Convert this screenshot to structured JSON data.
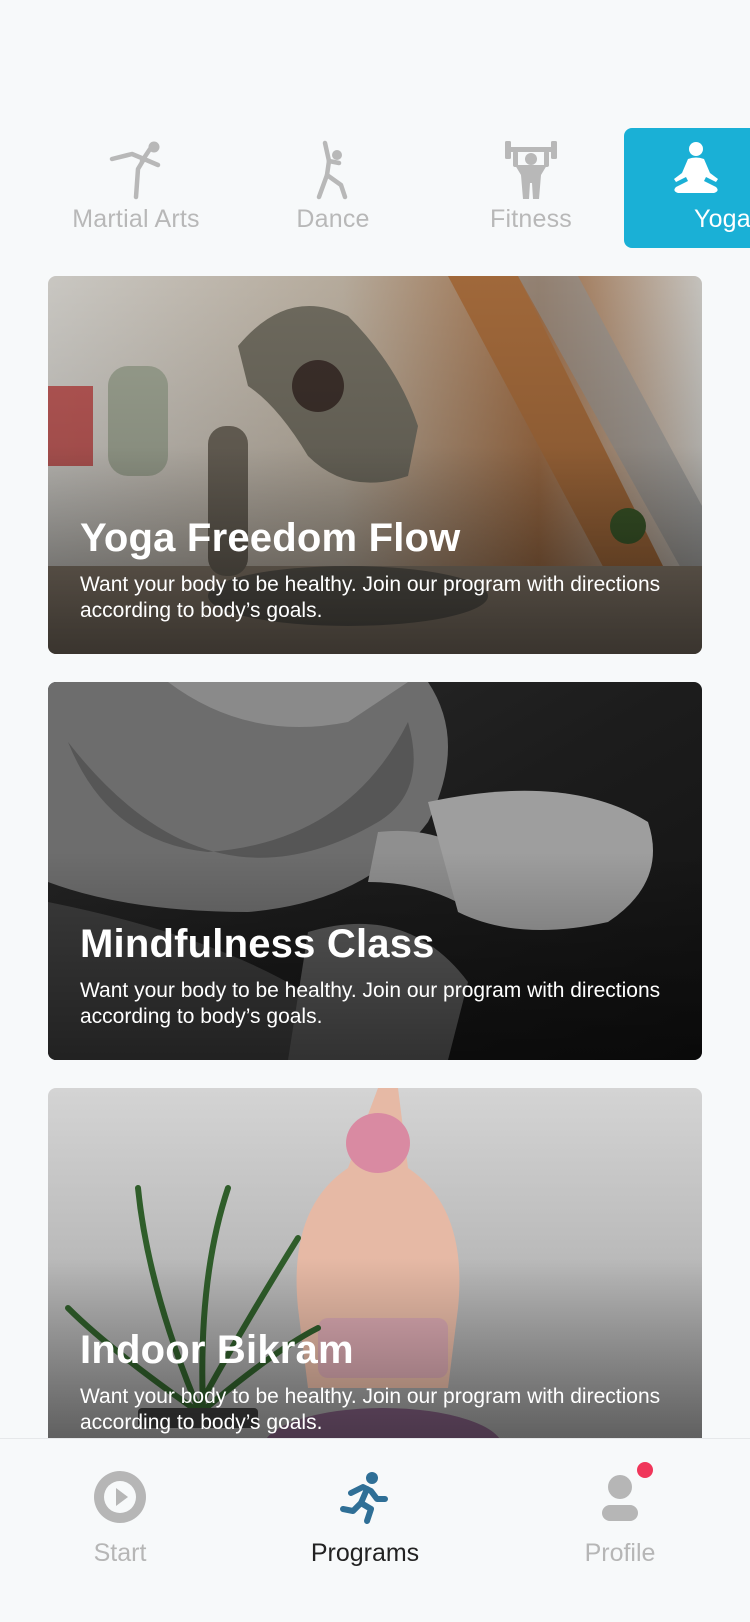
{
  "categories": [
    {
      "label": "Martial Arts",
      "icon": "martial-arts-icon",
      "selected": false
    },
    {
      "label": "Dance",
      "icon": "dance-icon",
      "selected": false
    },
    {
      "label": "Fitness",
      "icon": "fitness-icon",
      "selected": false
    },
    {
      "label": "Yoga",
      "icon": "yoga-icon",
      "selected": true
    }
  ],
  "programs": [
    {
      "title": "Yoga Freedom Flow",
      "description": "Want your body to be healthy. Join our program with directions according to body’s goals."
    },
    {
      "title": "Mindfulness Class",
      "description": "Want your body to be healthy. Join our program with directions according to body’s goals."
    },
    {
      "title": "Indoor Bikram",
      "description": "Want your body to be healthy. Join our program with directions according to body’s goals."
    }
  ],
  "nav": {
    "items": [
      {
        "label": "Start",
        "icon": "play-circle-icon"
      },
      {
        "label": "Programs",
        "icon": "running-person-icon"
      },
      {
        "label": "Profile",
        "icon": "user-icon"
      }
    ],
    "active": "Programs"
  },
  "colors": {
    "accent": "#1ab0d6",
    "nav_active_icon": "#2f6f96",
    "notification": "#f0365a",
    "inactive": "#b8b8b8"
  }
}
